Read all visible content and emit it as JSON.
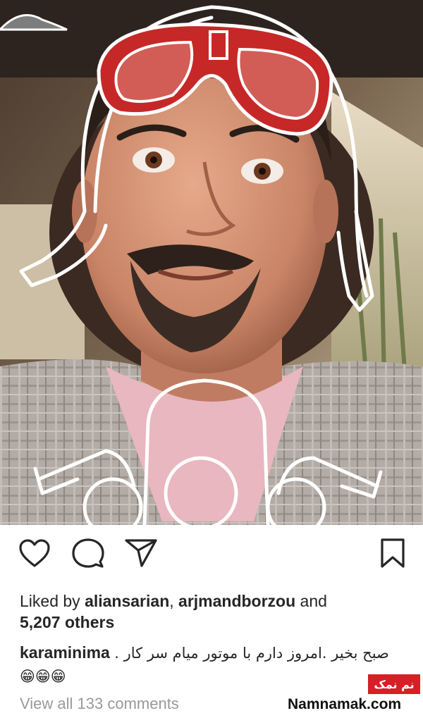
{
  "post": {
    "photo_icon": "selfie-with-aviator-doodle",
    "actions": {
      "like_icon": "heart-icon",
      "comment_icon": "comment-icon",
      "share_icon": "paper-plane-icon",
      "save_icon": "bookmark-icon"
    },
    "likes": {
      "prefix": "Liked by ",
      "user1": "aliansarian",
      "sep": ", ",
      "user2": "arjmandborzou",
      "and": " and",
      "others": "5,207 others"
    },
    "caption": {
      "username": "karaminima",
      "text": "صبح بخير .امروز دارم با موتور ميام سر كار .",
      "emojis": "😁😁😁"
    },
    "view_comments": "View all 133 comments"
  },
  "watermark": {
    "badge": "نم نمک",
    "site": "Namnamak.com"
  },
  "colors": {
    "text": "#262626",
    "muted": "#999999",
    "badge": "#d61f26",
    "goggle_red": "#c62828"
  }
}
